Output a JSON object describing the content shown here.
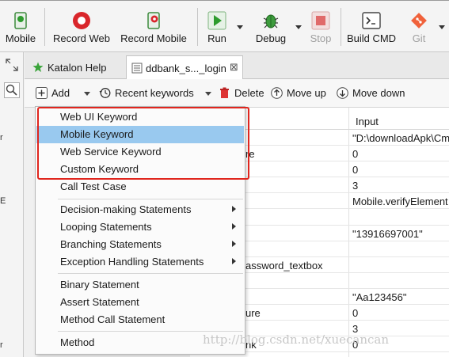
{
  "toolbar": {
    "mobile_label": "Mobile",
    "record_web_label": "Record Web",
    "record_mobile_label": "Record Mobile",
    "run_label": "Run",
    "debug_label": "Debug",
    "stop_label": "Stop",
    "build_cmd_label": "Build CMD",
    "git_label": "Git"
  },
  "tabs": [
    {
      "label": "Katalon Help"
    },
    {
      "label": "ddbank_s..._login"
    }
  ],
  "editor_toolbar": {
    "add_label": "Add",
    "recent_label": "Recent keywords",
    "delete_label": "Delete",
    "move_up_label": "Move up",
    "move_down_label": "Move down"
  },
  "table": {
    "input_header": "Input",
    "rows": [
      {
        "left": "",
        "input": "\"D:\\downloadApk\\Cm"
      },
      {
        "left": "re",
        "input": "0"
      },
      {
        "left": "",
        "input": "0"
      },
      {
        "left": "",
        "input": "3"
      },
      {
        "left": "",
        "input": "Mobile.verifyElement"
      },
      {
        "left": "",
        "input": ""
      },
      {
        "left": "",
        "input": "\"13916697001\""
      },
      {
        "left": "",
        "input": ""
      },
      {
        "left": "assword_textbox",
        "input": ""
      },
      {
        "left": "",
        "input": ""
      },
      {
        "left": "",
        "input": "\"Aa123456\""
      },
      {
        "left": "ure",
        "input": "0"
      },
      {
        "left": "",
        "input": "3"
      },
      {
        "left": "nk",
        "input": "0"
      }
    ]
  },
  "menu": {
    "items": [
      {
        "label": "Web UI Keyword"
      },
      {
        "label": "Mobile Keyword"
      },
      {
        "label": "Web Service Keyword"
      },
      {
        "label": "Custom Keyword"
      },
      {
        "label": "Call Test Case"
      },
      {
        "label": "Decision-making Statements"
      },
      {
        "label": "Looping Statements"
      },
      {
        "label": "Branching Statements"
      },
      {
        "label": "Exception Handling Statements"
      },
      {
        "label": "Binary Statement"
      },
      {
        "label": "Assert Statement"
      },
      {
        "label": "Method Call Statement"
      },
      {
        "label": "Method"
      }
    ],
    "highlight_color": "#99c9ef"
  },
  "left_strip": {
    "chars": [
      "r",
      "E",
      "r"
    ]
  },
  "watermark": "http://blog.csdn.net/xuecancan",
  "colors": {
    "run_green": "#2e9c2e",
    "record_red": "#d9262b",
    "stop_red": "#e06a6a",
    "git_orange": "#f0623b",
    "annotation_red": "#e0261e"
  }
}
